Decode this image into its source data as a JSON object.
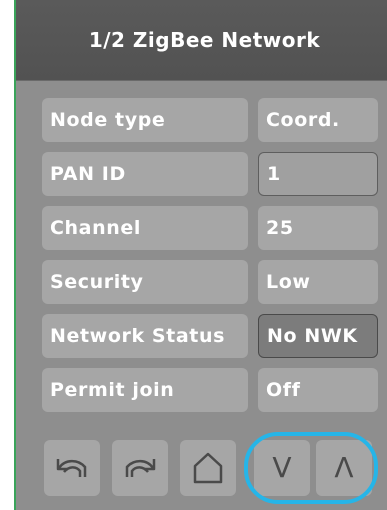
{
  "header": {
    "title": "1/2 ZigBee Network"
  },
  "rows": [
    {
      "label": "Node type",
      "value": "Coord."
    },
    {
      "label": "PAN ID",
      "value": "1"
    },
    {
      "label": "Channel",
      "value": "25"
    },
    {
      "label": "Security",
      "value": "Low"
    },
    {
      "label": "Network Status",
      "value": "No NWK"
    },
    {
      "label": "Permit join",
      "value": "Off"
    }
  ],
  "nav": {
    "down_glyph": "V",
    "up_glyph": "Λ",
    "icons": [
      "undo-icon",
      "redo-icon",
      "home-icon",
      "chevron-down-icon",
      "chevron-up-icon"
    ]
  },
  "colors": {
    "screen_bg": "#8e8e8e",
    "titlebar_bg": "#555555",
    "cell_bg": "#a6a6a6",
    "highlight_ring": "#26b5e8"
  }
}
